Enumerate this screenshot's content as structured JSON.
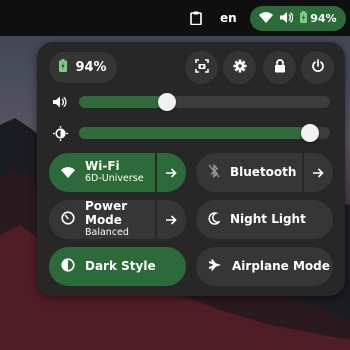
{
  "colors": {
    "accent": "#2d6a3a",
    "panel": "#272727",
    "tile_off": "#363636"
  },
  "topbar": {
    "clipboard_icon": "clipboard-icon",
    "language": "en",
    "status": {
      "battery": "94%"
    }
  },
  "quick_settings": {
    "battery": {
      "percent": "94%"
    },
    "buttons": [
      "screenshot-icon",
      "gear-icon",
      "lock-icon",
      "power-icon"
    ],
    "volume": {
      "level": 0.35
    },
    "brightness": {
      "level": 0.92
    },
    "tiles": {
      "wifi": {
        "title": "Wi-Fi",
        "subtitle": "6D-Universe",
        "state": "on"
      },
      "bluetooth": {
        "title": "Bluetooth",
        "state": "off"
      },
      "power_mode": {
        "title": "Power Mode",
        "subtitle": "Balanced",
        "state": "off"
      },
      "night_light": {
        "title": "Night Light",
        "state": "off"
      },
      "dark_style": {
        "title": "Dark Style",
        "state": "on"
      },
      "airplane_mode": {
        "title": "Airplane Mode",
        "state": "off"
      }
    }
  }
}
